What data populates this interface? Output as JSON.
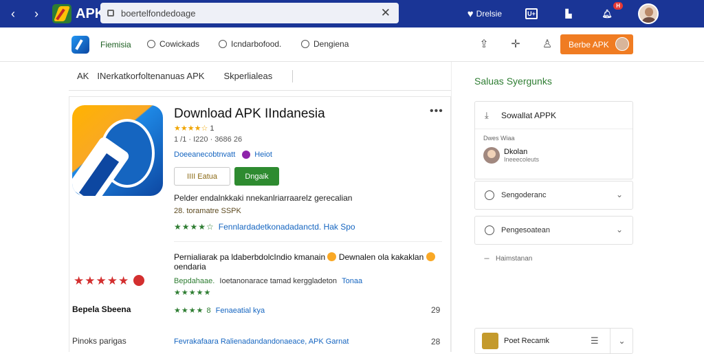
{
  "topbar": {
    "brand": "APK",
    "search_value": "boertelfondedoage",
    "wishlist_label": "Drelsie",
    "box_label": "U+",
    "badge": "H"
  },
  "toolbar": {
    "active_tab": "Fiemisia",
    "tabs": [
      "Cowickads",
      "Icndarbofood.",
      "Dengiena"
    ],
    "cta_label": "Berbe APK"
  },
  "breadcrumb": {
    "root": "AK",
    "middle": "INerkatkorfoltenanuas APK",
    "current": "Skperlialeas"
  },
  "app": {
    "title": "Download APK IIndanesia",
    "rating_stars": "★★★★☆",
    "rating_count": "1",
    "meta": "1 /1 · I220 · 3686 26",
    "developer": "Doeeanecobtnvatt",
    "tag": "Heiot",
    "btn_secondary": "IIII Eatua",
    "btn_primary": "Dngaik",
    "desc1": "Pelder endalnkkaki nnekanlriarraarelz gerecalian",
    "desc2": "28. toramatre SSPK",
    "rev_stars": "★★★★☆",
    "rev_link": "Fennlardadetkonadadanctd. Hak Spo"
  },
  "reviews": {
    "text_a": "Pernialiarak pa ldaberbdolcIndio kmanain",
    "text_b": "Dewnalen ola kakaklan",
    "text_c": "oendaria",
    "red_stars": "★★★★★",
    "sub_green": "Bepdahaae.",
    "sub_dark": "Ioetanonarace tamad kerggladeton",
    "sub_blue": "Tonaa",
    "small_stars": "★★★★★",
    "row1_label": "Bepela Sbeena",
    "row1_stars": "★★★★ 8",
    "row1_link": "Fenaeatial kya",
    "row1_num": "29",
    "row2_label": "Pinoks parigas",
    "row2_text": "Fevrakafaara Ralienadandandonaeace, APK Garnat",
    "row2_num": "28"
  },
  "sidebar": {
    "title": "Saluas Syergunks",
    "card_head": "Sowallat APPK",
    "card_sublabel": "Dwes Wiaa",
    "person_name": "Dkolan",
    "person_sub": "Ineeecoleuts",
    "accordion1": "Sengoderanc",
    "accordion2": "Pengesoatean",
    "link": "Haimstanan",
    "bottom_card": "Poet Recamk"
  }
}
